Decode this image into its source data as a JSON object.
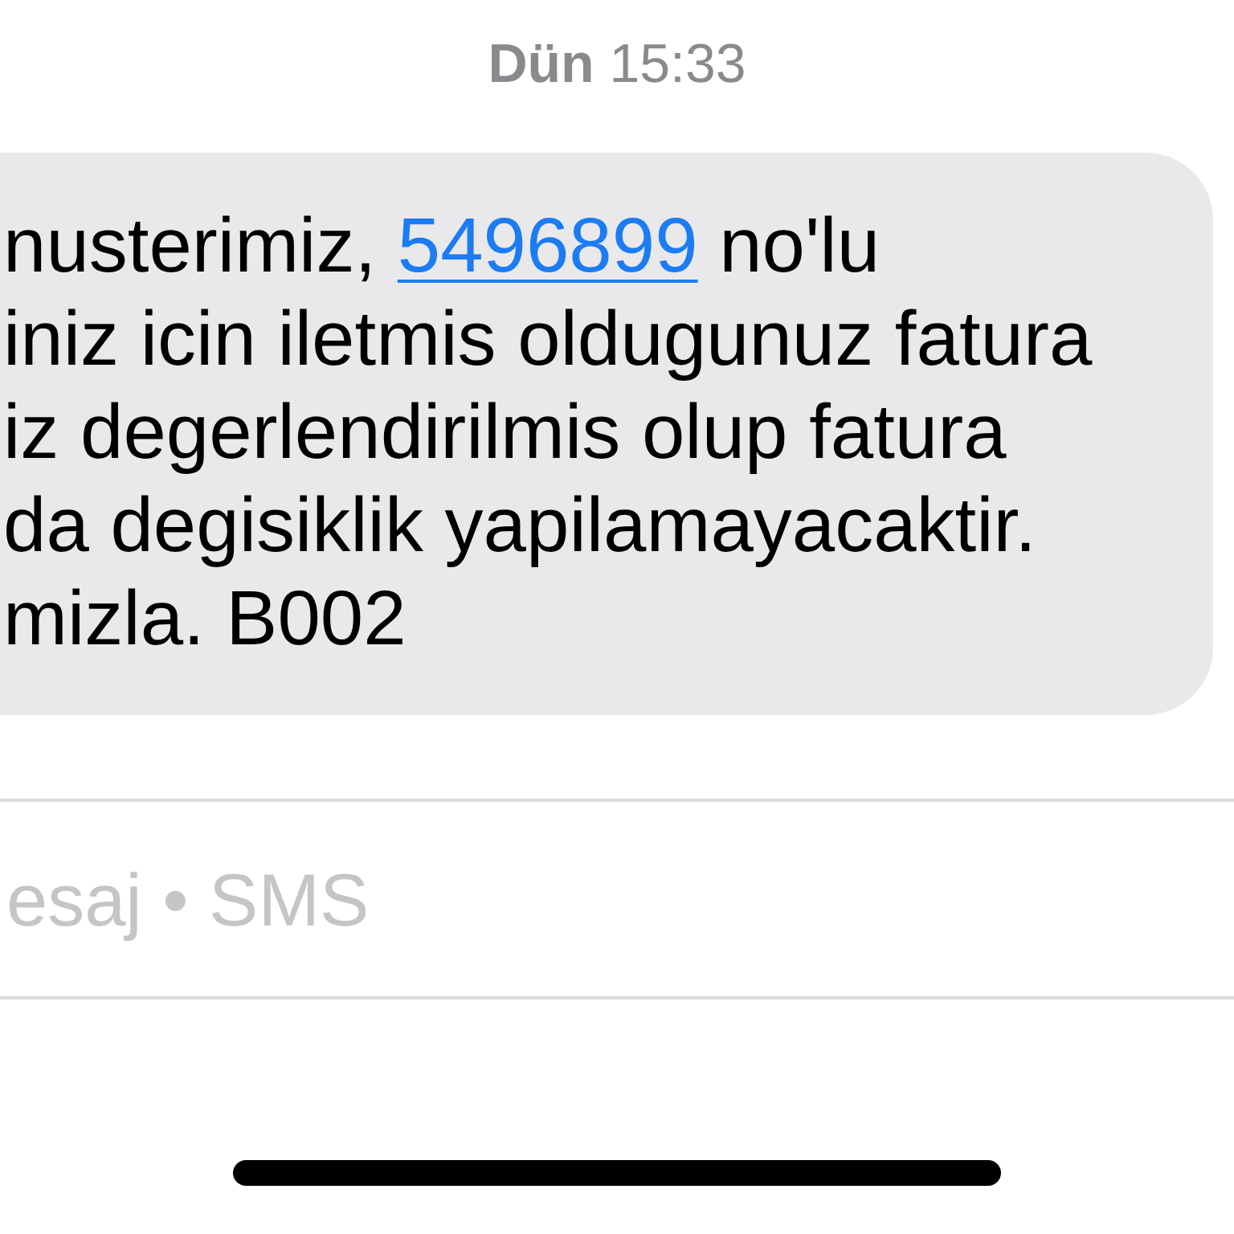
{
  "timestamp": "**Dün** 15:33",
  "message": {
    "lines": [
      [
        {
          "kind": "text",
          "text": "nusterimiz, "
        },
        {
          "kind": "link",
          "text": "5496899"
        },
        {
          "kind": "text",
          "text": " no'lu"
        }
      ],
      [
        {
          "kind": "text",
          "text": "iniz icin iletmis oldugunuz fatura"
        }
      ],
      [
        {
          "kind": "text",
          "text": "iz degerlendirilmis olup fatura"
        }
      ],
      [
        {
          "kind": "text",
          "text": "da degisiklik yapilamayacaktir."
        }
      ],
      [
        {
          "kind": "text",
          "text": "mizla. B002"
        }
      ]
    ]
  },
  "composer": {
    "placeholder": "esaj • SMS"
  }
}
